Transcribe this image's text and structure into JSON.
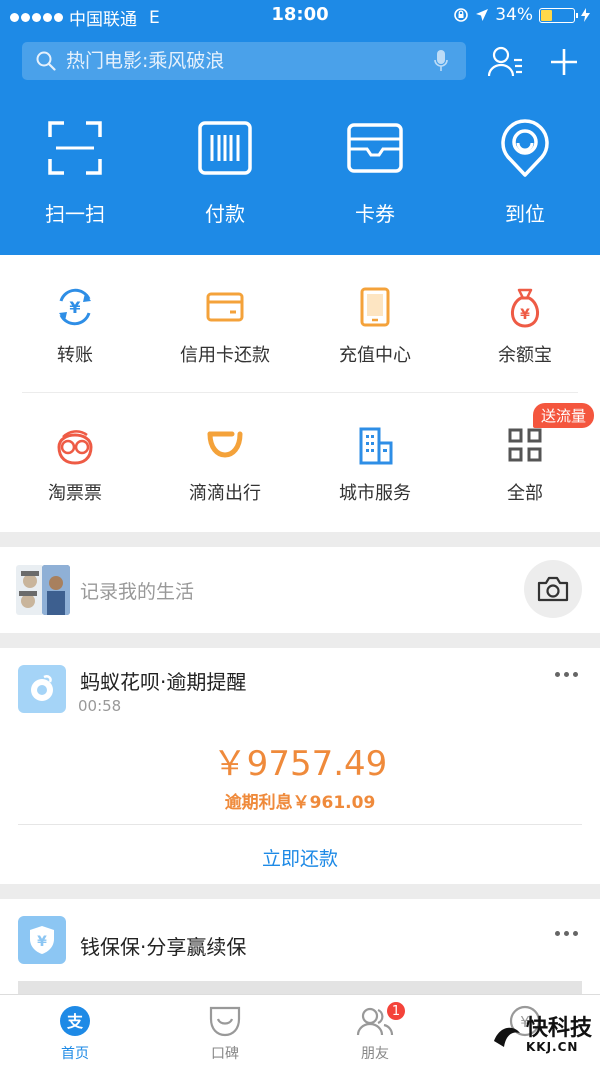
{
  "status_bar": {
    "carrier": "中国联通",
    "network": "E",
    "time": "18:00",
    "battery": "34%",
    "battery_level": 0.34
  },
  "header": {
    "search_placeholder": "热门电影:乘风破浪",
    "quick_actions": [
      {
        "label": "扫一扫",
        "icon": "scan-icon"
      },
      {
        "label": "付款",
        "icon": "barcode-icon"
      },
      {
        "label": "卡券",
        "icon": "wallet-icon"
      },
      {
        "label": "到位",
        "icon": "location-pin-icon"
      }
    ]
  },
  "services": {
    "row1": [
      {
        "label": "转账",
        "icon": "transfer-icon",
        "color": "#2e8ee6"
      },
      {
        "label": "信用卡还款",
        "icon": "credit-card-icon",
        "color": "#f4a23a"
      },
      {
        "label": "充值中心",
        "icon": "phone-icon",
        "color": "#f4a23a"
      },
      {
        "label": "余额宝",
        "icon": "money-bag-icon",
        "color": "#ee5b45"
      }
    ],
    "row2": [
      {
        "label": "淘票票",
        "icon": "glasses-face-icon",
        "color": "#ee5b45"
      },
      {
        "label": "滴滴出行",
        "icon": "didi-icon",
        "color": "#f4a23a"
      },
      {
        "label": "城市服务",
        "icon": "building-icon",
        "color": "#2e8ee6"
      },
      {
        "label": "全部",
        "icon": "grid-icon",
        "color": "#555555"
      }
    ],
    "promo_badge": "送流量"
  },
  "life": {
    "placeholder": "记录我的生活"
  },
  "huabei_card": {
    "title": "蚂蚁花呗·逾期提醒",
    "time": "00:58",
    "amount": "￥9757.49",
    "interest": "逾期利息￥961.09",
    "action": "立即还款"
  },
  "qbb_card": {
    "title": "钱保保·分享赢续保"
  },
  "tabbar": {
    "tabs": [
      {
        "label": "首页",
        "active": true
      },
      {
        "label": "口碑",
        "active": false
      },
      {
        "label": "朋友",
        "active": false,
        "badge": "1"
      },
      {
        "label": "",
        "active": false
      }
    ]
  },
  "watermark": {
    "main": "快科技",
    "sub": "KKJ.CN"
  },
  "colors": {
    "brand_blue": "#1e8ae6",
    "orange": "#ef8a3b",
    "red_badge": "#f4433a"
  }
}
